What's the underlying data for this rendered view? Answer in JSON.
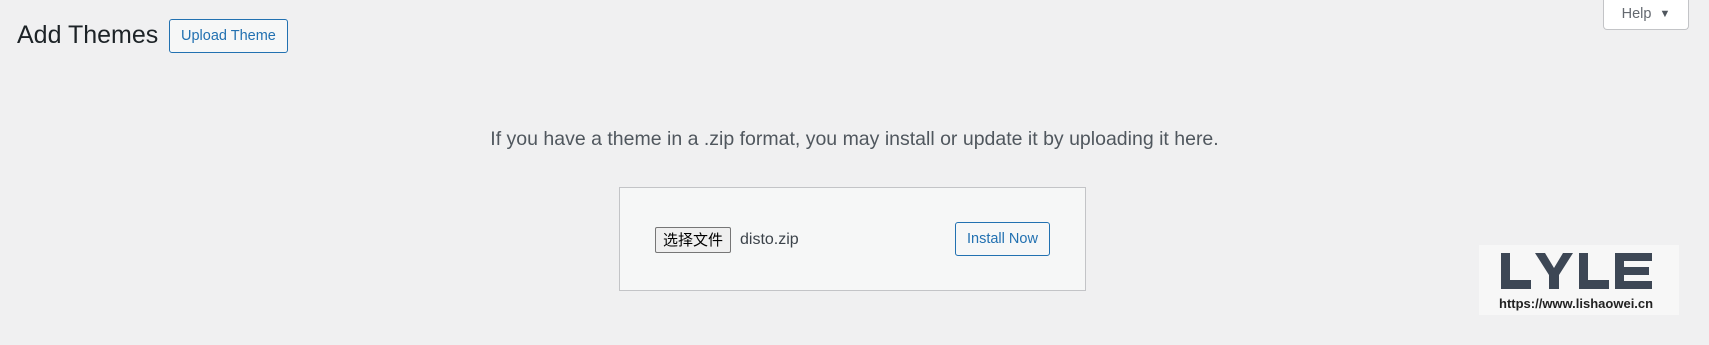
{
  "header": {
    "title": "Add Themes",
    "upload_button_label": "Upload Theme",
    "help_label": "Help"
  },
  "upload": {
    "description": "If you have a theme in a .zip format, you may install or update it by uploading it here.",
    "choose_file_label": "选择文件",
    "selected_file": "disto.zip",
    "install_button_label": "Install Now"
  },
  "watermark": {
    "logo_text": "LYLE",
    "url": "https://www.lishaowei.cn"
  },
  "icons": {
    "help_caret": "caret-down-icon"
  },
  "colors": {
    "accent": "#2271b1",
    "background": "#f0f0f1",
    "logo": "#3d4755"
  }
}
